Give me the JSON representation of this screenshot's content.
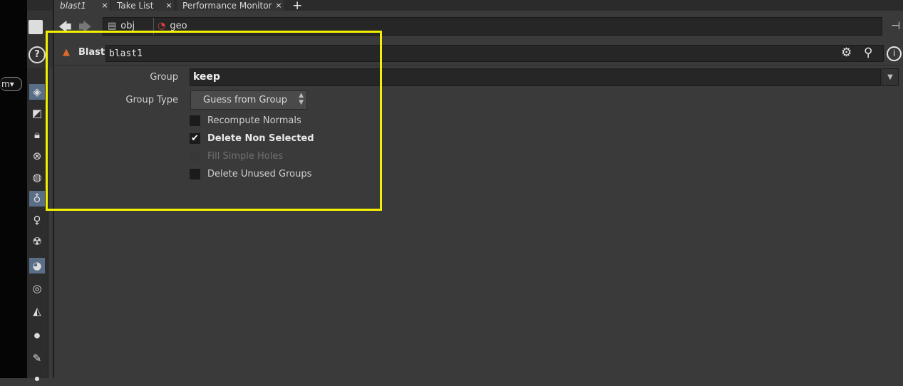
{
  "tabs": [
    {
      "label": "blast1",
      "close": "×"
    },
    {
      "label": "Take List",
      "close": "×"
    },
    {
      "label": "Performance Monitor",
      "close": "×"
    }
  ],
  "tab_add": "+",
  "path": {
    "crumbs": [
      "obj",
      "geo"
    ],
    "back_icon": "arrow-left-icon",
    "forward_icon": "arrow-right-icon"
  },
  "left_panel": {
    "dropdown_label": "m",
    "tools": [
      "layers-icon",
      "uv-icon",
      "lock-icon",
      "light-off-icon",
      "dome-light-icon",
      "light-bulb-icon",
      "point-light-icon",
      "spot-light-icon",
      "camera-lights-icon",
      "eye-icon",
      "stereo-camera-icon",
      "dot-icon",
      "brush-icon"
    ]
  },
  "node": {
    "type_label": "Blast",
    "name": "blast1",
    "icon": "blast-sop-icon"
  },
  "params": {
    "group_label": "Group",
    "group_value": "keep",
    "grouptype_label": "Group Type",
    "grouptype_value": "Guess from Group",
    "toggles": [
      {
        "label": "Recompute Normals",
        "checked": false,
        "enabled": true
      },
      {
        "label": "Delete Non Selected",
        "checked": true,
        "enabled": true
      },
      {
        "label": "Fill Simple Holes",
        "checked": false,
        "enabled": false
      },
      {
        "label": "Delete Unused Groups",
        "checked": false,
        "enabled": true
      }
    ]
  },
  "colors": {
    "highlight": "#f3f000",
    "background": "#3a3a3a",
    "field": "#262626"
  }
}
